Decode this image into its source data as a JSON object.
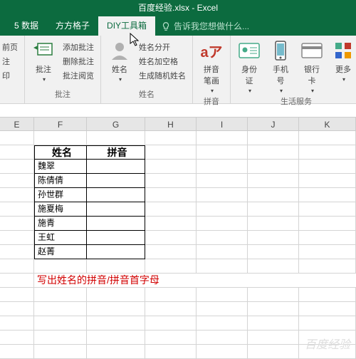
{
  "title": "百度经验.xlsx - Excel",
  "tabs": {
    "data": "5 数据",
    "ffgz": "方方格子",
    "diy": "DIY工具箱"
  },
  "tellme": {
    "label": "告诉我您想做什么..."
  },
  "ribbon": {
    "g1": {
      "items": [
        "前页",
        "注",
        "印"
      ]
    },
    "g2": {
      "big": "批注",
      "items": [
        "添加批注",
        "删除批注",
        "批注阅览"
      ],
      "label": "批注"
    },
    "g3": {
      "big": "姓名",
      "items": [
        "姓名分开",
        "姓名加空格",
        "生成随机姓名"
      ],
      "label": "姓名"
    },
    "g4": {
      "big": "拼音笔画",
      "label": "拼音",
      "glyph": "aア"
    },
    "g5": {
      "idcard": "身份证",
      "phone": "手机号",
      "bank": "银行卡",
      "more": "更多",
      "label": "生活服务"
    }
  },
  "cols": [
    "E",
    "F",
    "G",
    "H",
    "I",
    "J",
    "K"
  ],
  "headers": {
    "name": "姓名",
    "py": "拼音"
  },
  "names": [
    "魏翠",
    "陈倩倩",
    "孙世群",
    "施夏梅",
    "施青",
    "王虹",
    "赵菁"
  ],
  "note": "写出姓名的拼音/拼音首字母",
  "watermark": "百度经验"
}
